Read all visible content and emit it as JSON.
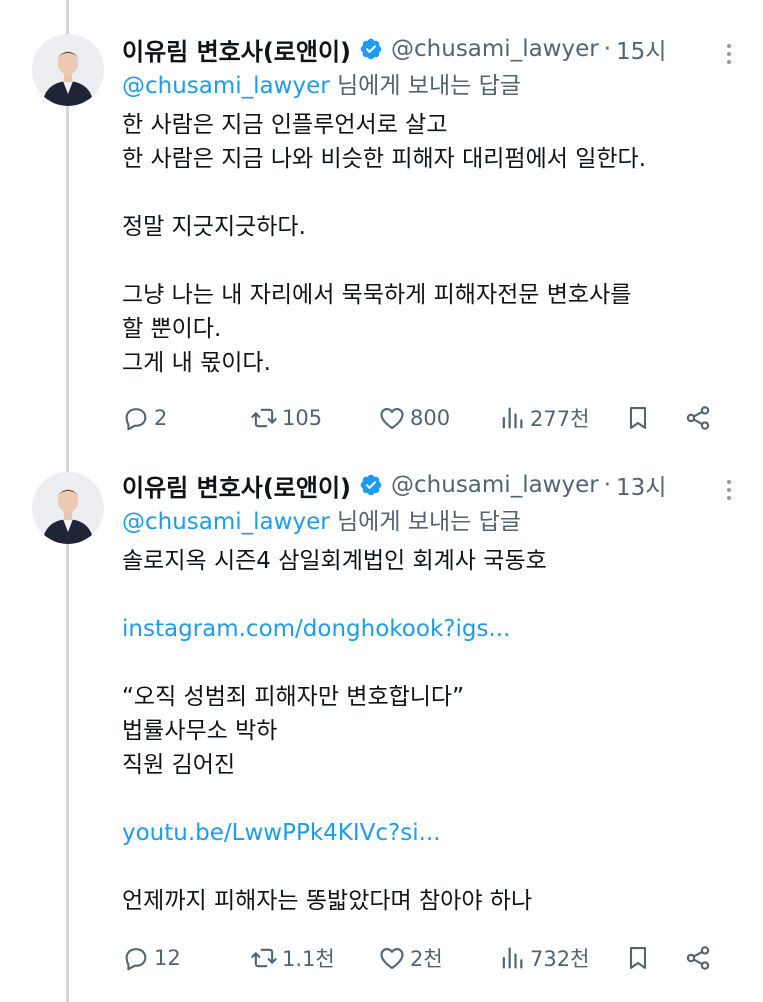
{
  "tweets": [
    {
      "author_name": "이유림 변호사(로앤이)",
      "handle": "@chusami_lawyer",
      "separator": "·",
      "time": "15시",
      "reply_mention": "@chusami_lawyer",
      "reply_suffix": " 님에게 보내는 답글",
      "lines": [
        {
          "text": "한 사람은 지금 인플루언서로 살고",
          "is_link": false
        },
        {
          "text": "한 사람은 지금 나와 비슷한 피해자 대리펌에서 일한다.",
          "is_link": false
        },
        {
          "text": "",
          "is_link": false
        },
        {
          "text": "정말 지긋지긋하다.",
          "is_link": false
        },
        {
          "text": "",
          "is_link": false
        },
        {
          "text": "그냥 나는 내 자리에서 묵묵하게 피해자전문 변호사를",
          "is_link": false
        },
        {
          "text": "할 뿐이다.",
          "is_link": false
        },
        {
          "text": "그게 내 몫이다.",
          "is_link": false
        }
      ],
      "stats": {
        "replies": "2",
        "retweets": "105",
        "likes": "800",
        "views": "277천"
      }
    },
    {
      "author_name": "이유림 변호사(로앤이)",
      "handle": "@chusami_lawyer",
      "separator": "·",
      "time": "13시",
      "reply_mention": "@chusami_lawyer",
      "reply_suffix": " 님에게 보내는 답글",
      "lines": [
        {
          "text": "솔로지옥 시즌4 삼일회계법인 회계사 국동호",
          "is_link": false
        },
        {
          "text": "",
          "is_link": false
        },
        {
          "text": "instagram.com/donghokook?igs...",
          "is_link": true
        },
        {
          "text": "",
          "is_link": false
        },
        {
          "text": "“오직 성범죄 피해자만 변호합니다”",
          "is_link": false
        },
        {
          "text": "법률사무소 박하",
          "is_link": false
        },
        {
          "text": "직원 김어진",
          "is_link": false
        },
        {
          "text": "",
          "is_link": false
        },
        {
          "text": "youtu.be/LwwPPk4KIVc?si...",
          "is_link": true
        },
        {
          "text": "",
          "is_link": false
        },
        {
          "text": "언제까지 피해자는 똥밟았다며 참아야 하나",
          "is_link": false
        }
      ],
      "stats": {
        "replies": "12",
        "retweets": "1.1천",
        "likes": "2천",
        "views": "732천"
      }
    }
  ],
  "colors": {
    "link": "#1d9bf0",
    "muted": "#536471",
    "text": "#0f1419",
    "verified": "#1d9bf0",
    "thread_line": "#cfd9de"
  },
  "icons": [
    "more-icon",
    "verified-badge-icon",
    "reply-icon",
    "retweet-icon",
    "like-icon",
    "views-icon",
    "bookmark-icon",
    "share-icon"
  ]
}
